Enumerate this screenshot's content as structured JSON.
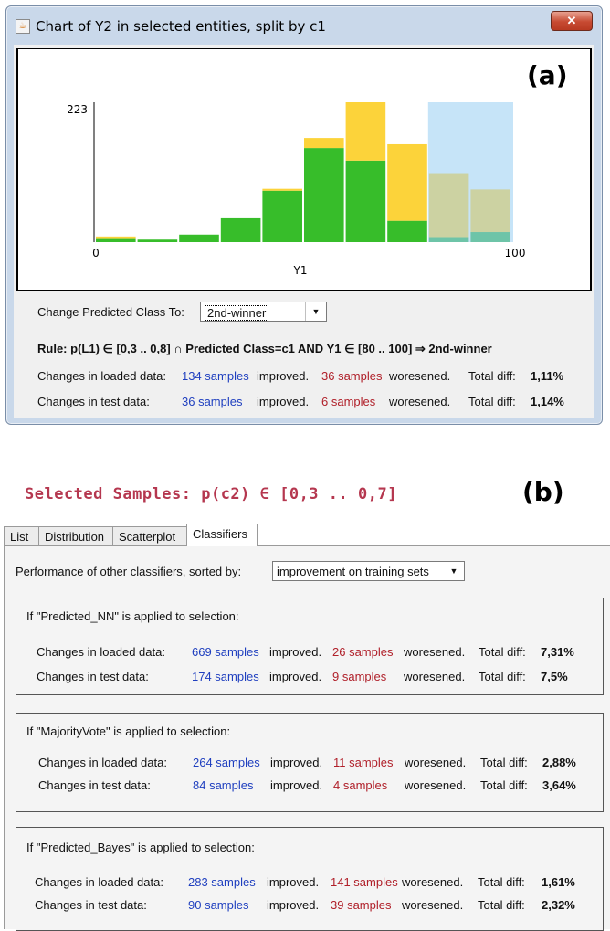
{
  "window": {
    "title": "Chart of Y2 in selected entities, split by c1",
    "close_label": "✕",
    "panel_tag": "(a)"
  },
  "chart_data": {
    "type": "bar",
    "stacked": true,
    "x_min_label": "0",
    "x_max_label": "100",
    "y_max_label": "223",
    "xlabel": "Y1",
    "ylim": [
      0,
      223
    ],
    "xlim": [
      0,
      100
    ],
    "bins": [
      {
        "x0": 0,
        "x1": 10,
        "green": 5,
        "yellow": 4,
        "selected": false
      },
      {
        "x0": 10,
        "x1": 20,
        "green": 4,
        "yellow": 0,
        "selected": false
      },
      {
        "x0": 20,
        "x1": 30,
        "green": 12,
        "yellow": 0,
        "selected": false
      },
      {
        "x0": 30,
        "x1": 40,
        "green": 38,
        "yellow": 0,
        "selected": false
      },
      {
        "x0": 40,
        "x1": 50,
        "green": 82,
        "yellow": 3,
        "selected": false
      },
      {
        "x0": 50,
        "x1": 60,
        "green": 150,
        "yellow": 16,
        "selected": false
      },
      {
        "x0": 60,
        "x1": 70,
        "green": 130,
        "yellow": 93,
        "selected": false
      },
      {
        "x0": 70,
        "x1": 80,
        "green": 34,
        "yellow": 122,
        "selected": false
      },
      {
        "x0": 80,
        "x1": 90,
        "green": 8,
        "yellow": 102,
        "selected": true
      },
      {
        "x0": 90,
        "x1": 100,
        "green": 16,
        "yellow": 68,
        "selected": true
      }
    ],
    "colors": {
      "green": "#37bd2a",
      "yellow": "#fcd33a",
      "selection": "#c6e4f8",
      "green_selected": "#6ec4a8",
      "yellow_selected": "#ccd2a2"
    }
  },
  "controls": {
    "change_label": "Change Predicted Class To:",
    "selected_class": "2nd-winner",
    "rule_prefix": "Rule:",
    "rule_text": "p(L1) ∈ [0,3 .. 0,8] ∩ Predicted Class=c1 AND Y1 ∈ [80 .. 100] ⇒ 2nd-winner"
  },
  "stats_a": [
    {
      "label": "Changes in loaded data:",
      "improved": "134 samples",
      "improved_word": "improved.",
      "worsened": "36 samples",
      "worsened_word": "woresened.",
      "total_label": "Total diff:",
      "total": "1,11%"
    },
    {
      "label": "Changes in test data:",
      "improved": "36 samples",
      "improved_word": "improved.",
      "worsened": "6 samples",
      "worsened_word": "woresened.",
      "total_label": "Total diff:",
      "total": "1,14%"
    }
  ],
  "section_b": {
    "tag": "(b)",
    "title": "Selected Samples: p(c2) ∈ [0,3 .. 0,7]",
    "tabs": [
      "List",
      "Distribution",
      "Scatterplot",
      "Classifiers"
    ],
    "sort_label": "Performance of other classifiers, sorted by:",
    "sort_value": "improvement on training sets",
    "groups": [
      {
        "heading": "If \"Predicted_NN\" is applied to selection:",
        "rows": [
          {
            "label": "Changes in loaded data:",
            "improved": "669 samples",
            "improved_word": "improved.",
            "worsened": "26 samples",
            "worsened_word": "woresened.",
            "total_label": "Total diff:",
            "total": "7,31%"
          },
          {
            "label": "Changes in test data:",
            "improved": "174 samples",
            "improved_word": "improved.",
            "worsened": "9 samples",
            "worsened_word": "woresened.",
            "total_label": "Total diff:",
            "total": "7,5%"
          }
        ]
      },
      {
        "heading": "If \"MajorityVote\" is applied to selection:",
        "rows": [
          {
            "label": "Changes in loaded data:",
            "improved": "264 samples",
            "improved_word": "improved.",
            "worsened": "11 samples",
            "worsened_word": "woresened.",
            "total_label": "Total diff:",
            "total": "2,88%"
          },
          {
            "label": "Changes in test data:",
            "improved": "84 samples",
            "improved_word": "improved.",
            "worsened": "4 samples",
            "worsened_word": "woresened.",
            "total_label": "Total diff:",
            "total": "3,64%"
          }
        ]
      },
      {
        "heading": "If \"Predicted_Bayes\" is applied to selection:",
        "rows": [
          {
            "label": "Changes in loaded data:",
            "improved": "283 samples",
            "improved_word": "improved.",
            "worsened": "141 samples",
            "worsened_word": "woresened.",
            "total_label": "Total diff:",
            "total": "1,61%"
          },
          {
            "label": "Changes in test data:",
            "improved": "90 samples",
            "improved_word": "improved.",
            "worsened": "39 samples",
            "worsened_word": "woresened.",
            "total_label": "Total diff:",
            "total": "2,32%"
          }
        ]
      }
    ]
  }
}
